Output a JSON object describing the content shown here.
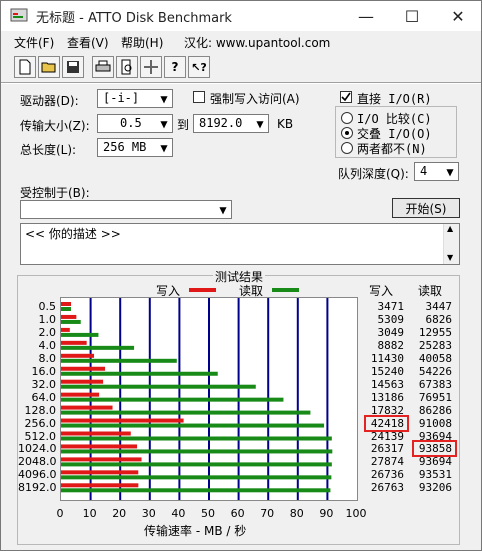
{
  "window": {
    "title": "无标题 - ATTO Disk Benchmark",
    "controls": [
      "—",
      "☐",
      "✕"
    ]
  },
  "menu": {
    "items": [
      "文件(F)",
      "查看(V)",
      "帮助(H)",
      "汉化: www.upantool.com"
    ]
  },
  "toolbar": {
    "buttons": [
      "new-icon",
      "open-folder-icon",
      "save-icon",
      "print-icon",
      "print-preview-icon",
      "move-icon",
      "help-icon",
      "context-help-icon"
    ]
  },
  "settings": {
    "drive_label": "驱动器(D):",
    "drive_value": "[-i-]",
    "force_write_label": "强制写入访问(A)",
    "force_write_checked": false,
    "transfer_label": "传输大小(Z):",
    "transfer_from": "0.5",
    "to_label": "到",
    "transfer_to": "8192.0",
    "transfer_unit": "KB",
    "length_label": "总长度(L):",
    "length_value": "256 MB",
    "direct_io_label": "直接 I/O(R)",
    "direct_io_checked": true,
    "radio_options": [
      "I/O 比较(C)",
      "交叠 I/O(O)",
      "两者都不(N)"
    ],
    "radio_selected": 1,
    "queue_label": "队列深度(Q):",
    "queue_value": "4",
    "controlled_label": "受控制于(B):",
    "controlled_value": "",
    "start_button": "开始(S)",
    "description": "<<   你的描述   >>"
  },
  "results": {
    "title": "测试结果",
    "legend_write": "写入",
    "legend_read": "读取",
    "col_write": "写入",
    "col_read": "读取",
    "colors": {
      "write": "#e01818",
      "read": "#178a17",
      "grid": "#00008b"
    }
  },
  "chart_data": {
    "type": "bar",
    "orientation": "horizontal",
    "categories": [
      "0.5",
      "1.0",
      "2.0",
      "4.0",
      "8.0",
      "16.0",
      "32.0",
      "64.0",
      "128.0",
      "256.0",
      "512.0",
      "1024.0",
      "2048.0",
      "4096.0",
      "8192.0"
    ],
    "series": [
      {
        "name": "写入",
        "values": [
          3471,
          5309,
          3049,
          8882,
          11430,
          15240,
          14563,
          13186,
          17832,
          42418,
          24139,
          26317,
          27874,
          26736,
          26763
        ]
      },
      {
        "name": "读取",
        "values": [
          3447,
          6826,
          12955,
          25283,
          40058,
          54226,
          67383,
          76951,
          86286,
          91008,
          93694,
          93858,
          93694,
          93531,
          93206
        ]
      }
    ],
    "x_ticks": [
      "0",
      "10",
      "20",
      "30",
      "40",
      "50",
      "60",
      "70",
      "80",
      "90",
      "100"
    ],
    "xlim": [
      0,
      100
    ],
    "xlabel": "传输速率 - MB / 秒",
    "highlighted": [
      {
        "series": 0,
        "index": 9
      },
      {
        "series": 1,
        "index": 11
      }
    ]
  }
}
